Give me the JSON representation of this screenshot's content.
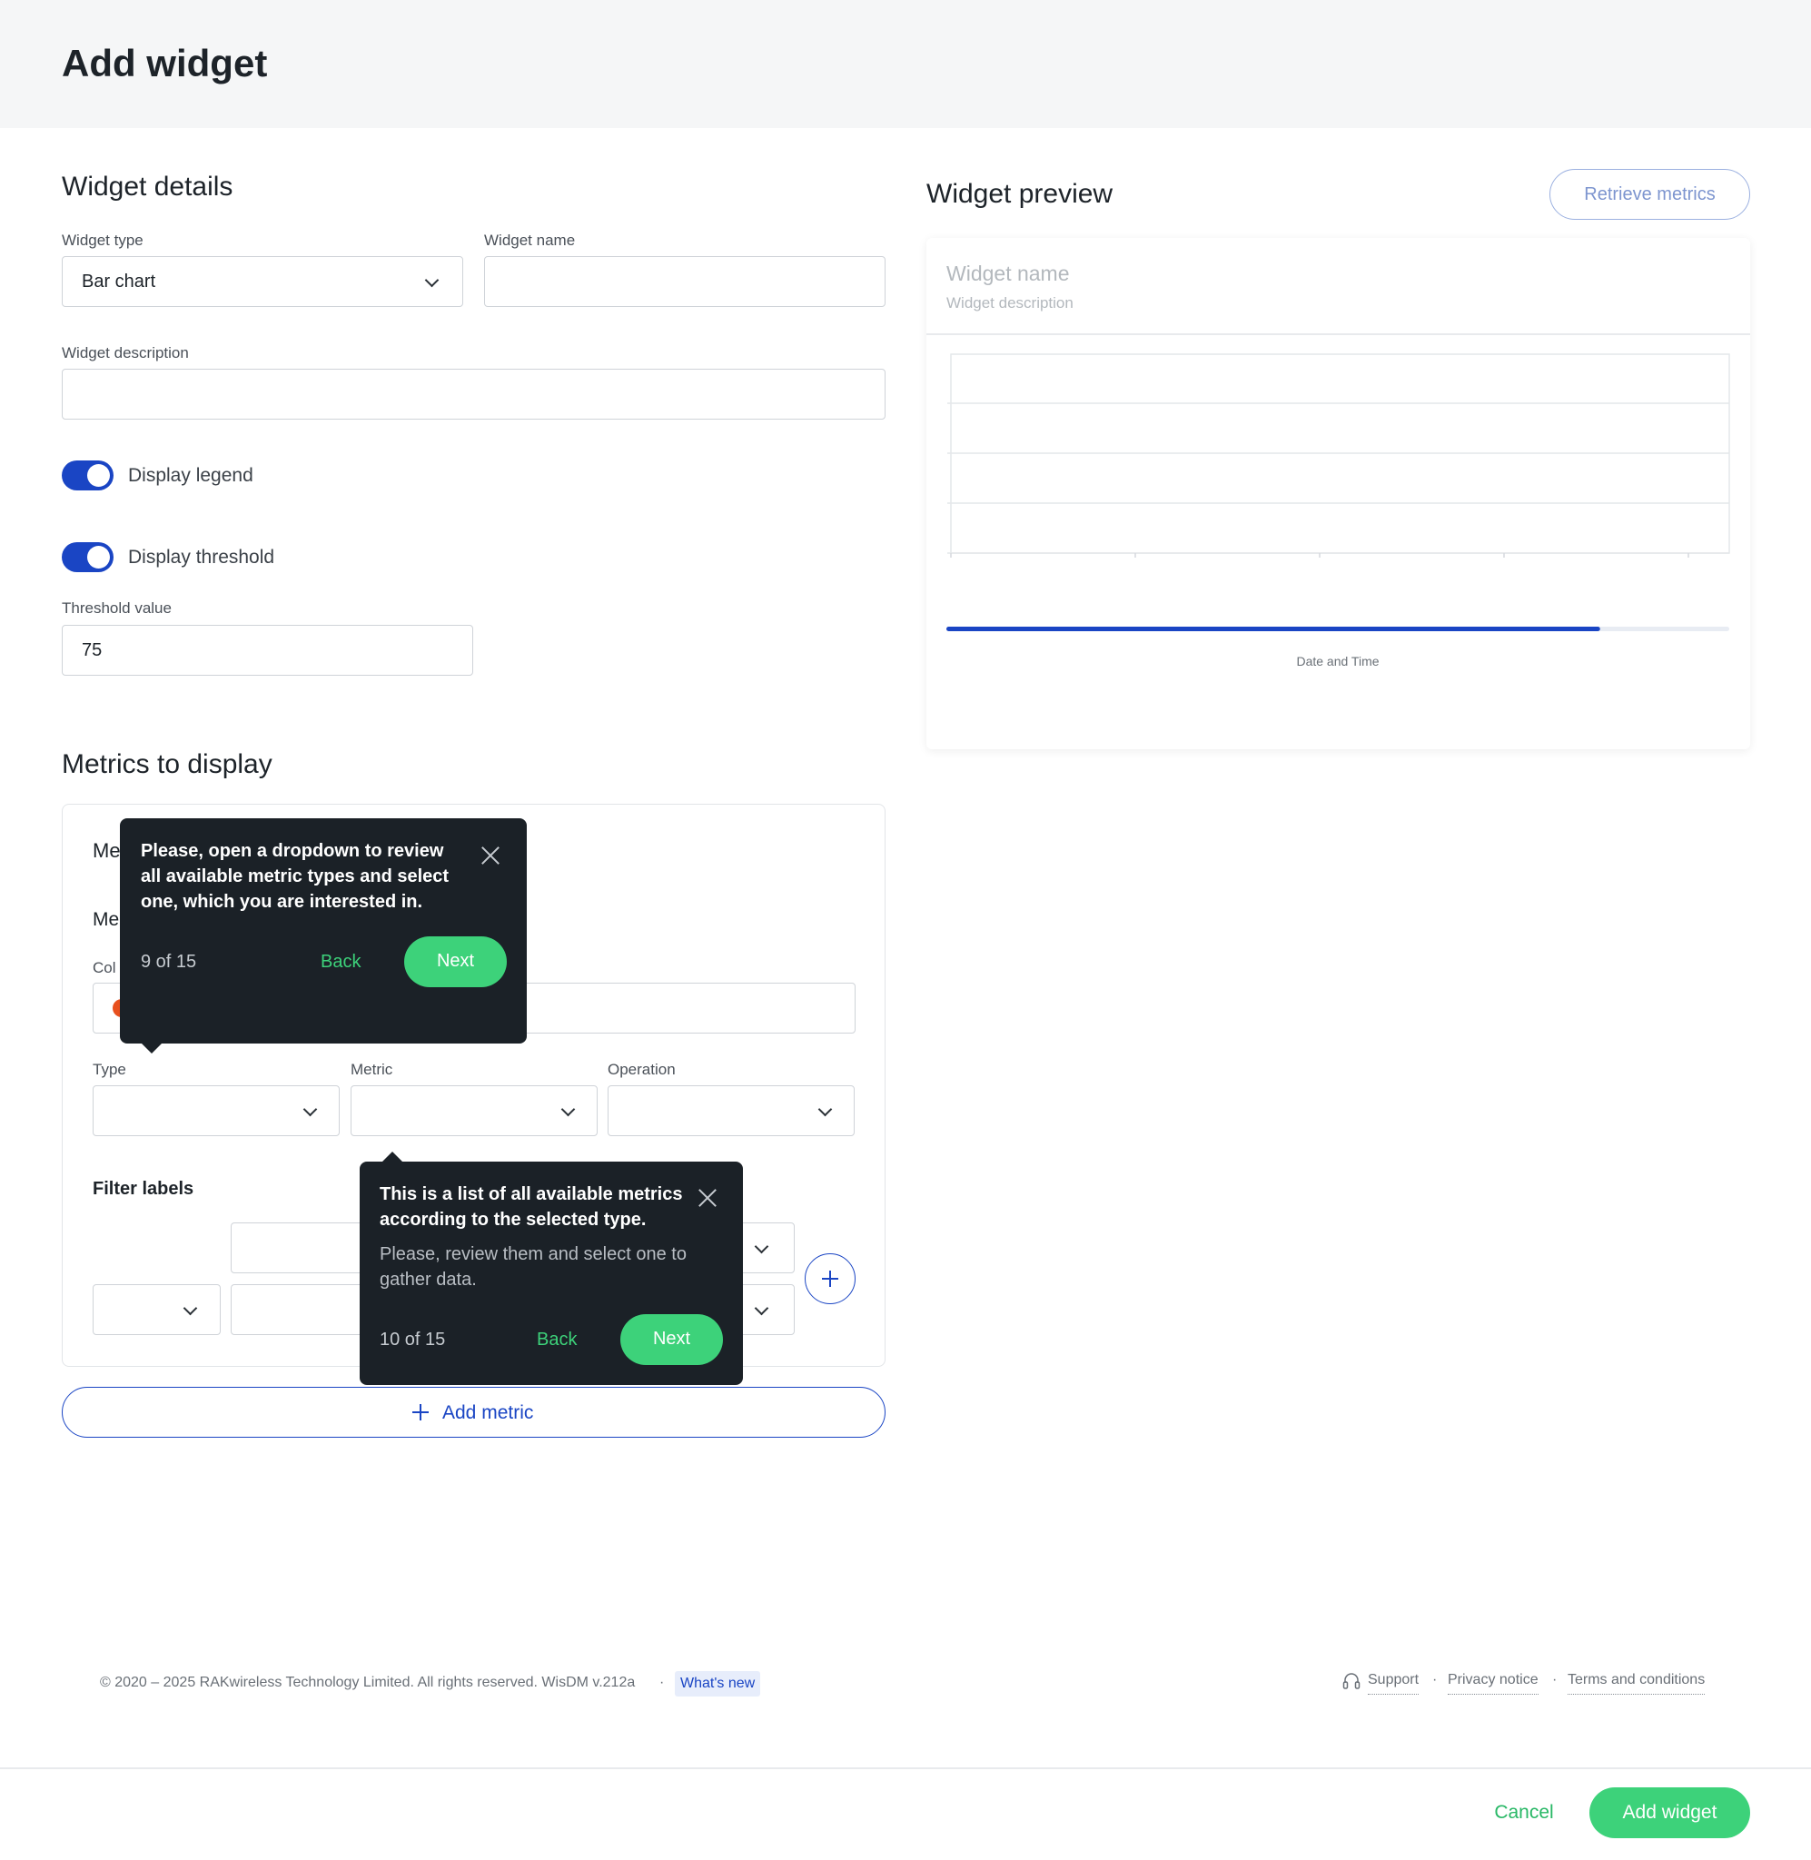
{
  "page": {
    "title": "Add widget"
  },
  "details": {
    "section_title": "Widget details",
    "widget_type": {
      "label": "Widget type",
      "value": "Bar chart"
    },
    "widget_name": {
      "label": "Widget name",
      "value": ""
    },
    "widget_description": {
      "label": "Widget description",
      "value": ""
    },
    "display_legend": {
      "label": "Display legend",
      "checked": true
    },
    "display_threshold": {
      "label": "Display threshold",
      "checked": true
    },
    "threshold_value": {
      "label": "Threshold value",
      "value": "75"
    }
  },
  "metrics": {
    "section_title": "Metrics to display",
    "card_heading_partial": "Me",
    "metric_label_partial": "Me",
    "color_label_partial": "Col",
    "type_label": "Type",
    "metric_label": "Metric",
    "operation_label": "Operation",
    "filter_labels_title": "Filter labels",
    "add_metric_label": "Add metric"
  },
  "preview": {
    "section_title": "Widget preview",
    "retrieve_label": "Retrieve metrics",
    "widget_name_placeholder": "Widget name",
    "widget_description_placeholder": "Widget description",
    "x_axis_label": "Date and Time",
    "range_slider_fraction": 0.835
  },
  "tooltips": [
    {
      "title": "Please, open a dropdown to review all available metric types and select one, which you are interested in.",
      "body": "",
      "step": "9 of 15",
      "back": "Back",
      "next": "Next"
    },
    {
      "title": "This is a list of all available metrics according to the selected type.",
      "body": "Please, review them and select one to gather data.",
      "step": "10 of 15",
      "back": "Back",
      "next": "Next"
    }
  ],
  "footer": {
    "copyright": "© 2020 – 2025 RAKwireless Technology Limited. All rights reserved. WisDM v.212a",
    "separator": "·",
    "whats_new": "What's new",
    "support": "Support",
    "privacy": "Privacy notice",
    "terms": "Terms and conditions"
  },
  "actions": {
    "cancel": "Cancel",
    "add_widget": "Add widget"
  },
  "colors": {
    "primary": "#1a45c4",
    "accent_green": "#3dd27a",
    "tooltip_bg": "#1b2127",
    "metric_color": "#e8501e"
  }
}
